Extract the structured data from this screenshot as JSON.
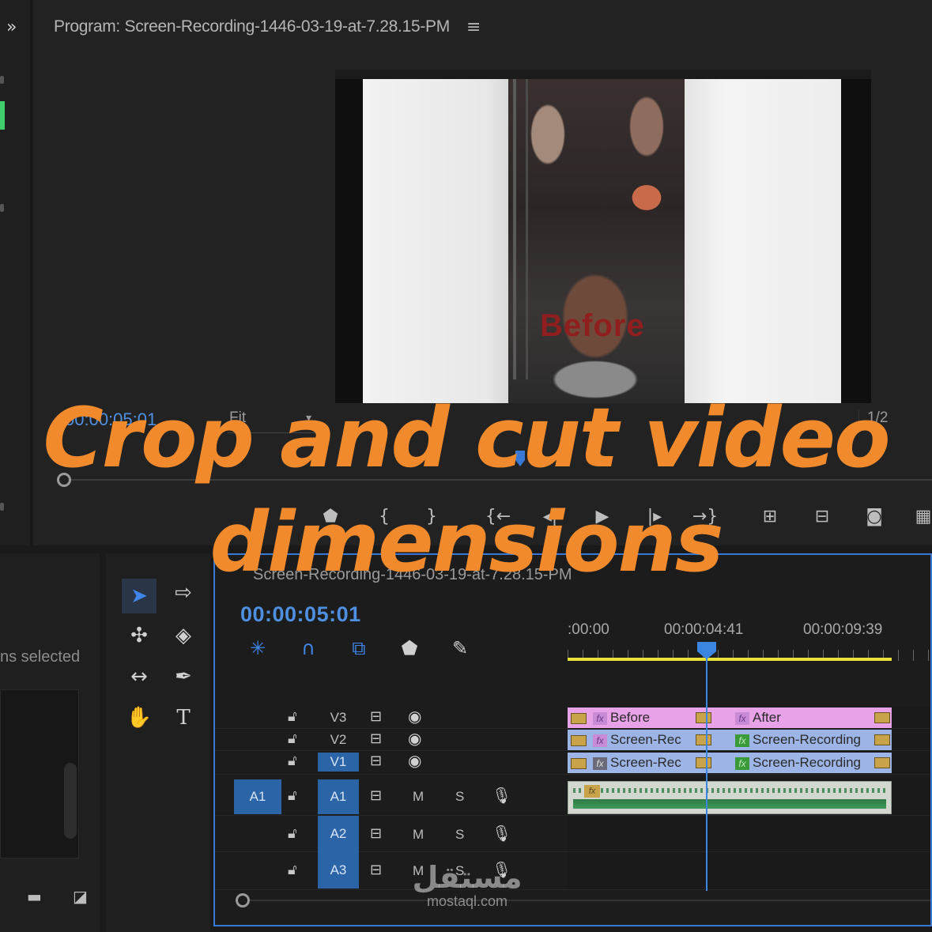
{
  "program_monitor": {
    "title": "Program: Screen-Recording-1446-03-19-at-7.28.15-PM",
    "timecode": "00:00:05:01",
    "zoom": "Fit",
    "resolution": "1/2",
    "video_overlay_text": "Before"
  },
  "project_panel": {
    "items_selected": "ns selected"
  },
  "timeline": {
    "sequence_tab": "Screen-Recording-1446-03-19-at-7.28.15-PM",
    "timecode": "00:00:05:01",
    "ruler": [
      ":00:00",
      "00:00:04:41",
      "00:00:09:39"
    ],
    "tracks_video": [
      {
        "name": "V3",
        "targeted": false
      },
      {
        "name": "V2",
        "targeted": false
      },
      {
        "name": "V1",
        "targeted": true
      }
    ],
    "tracks_audio": [
      {
        "name": "A1",
        "targeted": true,
        "source": "A1",
        "mute": "M",
        "solo": "S"
      },
      {
        "name": "A2",
        "targeted": true,
        "mute": "M",
        "solo": "S"
      },
      {
        "name": "A3",
        "targeted": true,
        "mute": "M",
        "solo": "S"
      }
    ],
    "clips": {
      "v3_a": "Before",
      "v3_b": "After",
      "v2_a": "Screen-Rec",
      "v2_b": "Screen-Recording",
      "v1_a": "Screen-Rec",
      "v1_b": "Screen-Recording"
    }
  },
  "headline": {
    "line1": "Crop and cut video",
    "line2": "dimensions",
    "color": "#f08a2c"
  },
  "watermark": {
    "arabic": "مستقل",
    "latin": "mostaql.com"
  },
  "colors": {
    "accent_blue": "#3a86e0",
    "work_area": "#e7e13a",
    "clip_pink": "#e8a2e8",
    "clip_blue": "#9db5e6"
  }
}
